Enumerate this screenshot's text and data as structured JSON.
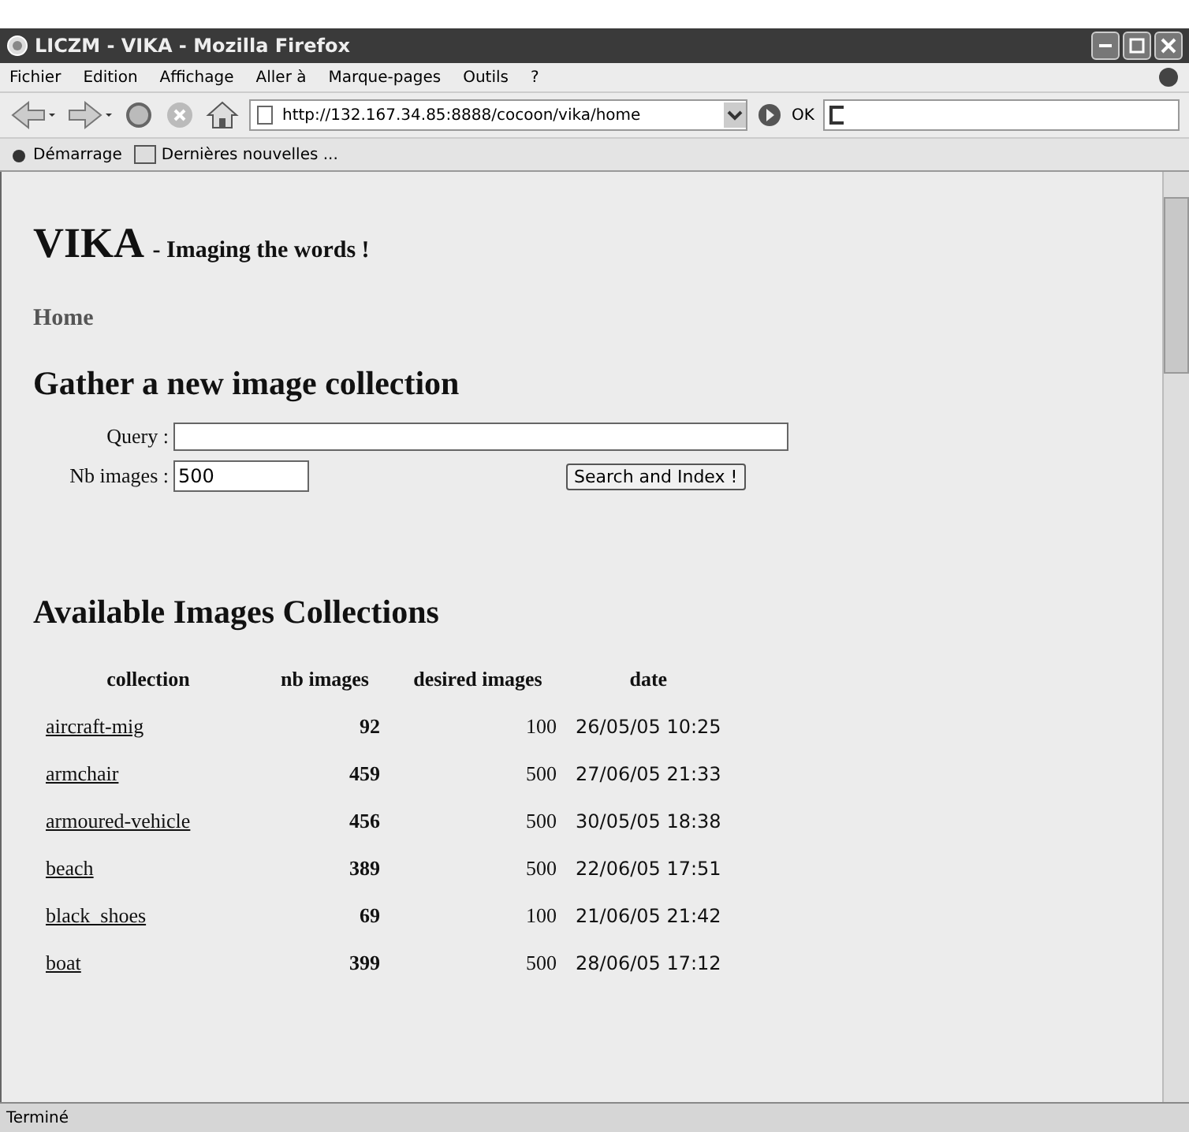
{
  "window": {
    "title": "LICZM - VIKA - Mozilla Firefox"
  },
  "menu": [
    "Fichier",
    "Edition",
    "Affichage",
    "Aller à",
    "Marque-pages",
    "Outils",
    "?"
  ],
  "toolbar": {
    "url": "http://132.167.34.85:8888/cocoon/vika/home",
    "go": "OK"
  },
  "bookmarks": [
    "Démarrage",
    "Dernières nouvelles ..."
  ],
  "page": {
    "title": "VIKA",
    "subtitle": "- Imaging the words !",
    "nav": "Home",
    "form_heading": "Gather a new image collection",
    "query": {
      "label": "Query :"
    },
    "nb_images": {
      "label": "Nb images :",
      "value": "500"
    },
    "submit": "Search and Index !",
    "table_heading": "Available Images Collections",
    "columns": [
      "collection",
      "nb images",
      "desired images",
      "date"
    ],
    "rows": [
      {
        "collection": "aircraft-mig",
        "nb": "92",
        "desired": "100",
        "date": "26/05/05 10:25"
      },
      {
        "collection": "armchair",
        "nb": "459",
        "desired": "500",
        "date": "27/06/05 21:33"
      },
      {
        "collection": "armoured-vehicle",
        "nb": "456",
        "desired": "500",
        "date": "30/05/05 18:38"
      },
      {
        "collection": "beach",
        "nb": "389",
        "desired": "500",
        "date": "22/06/05 17:51"
      },
      {
        "collection": "black_shoes",
        "nb": "69",
        "desired": "100",
        "date": "21/06/05 21:42"
      },
      {
        "collection": "boat",
        "nb": "399",
        "desired": "500",
        "date": "28/06/05 17:12"
      }
    ]
  },
  "status_bar": "Terminé"
}
